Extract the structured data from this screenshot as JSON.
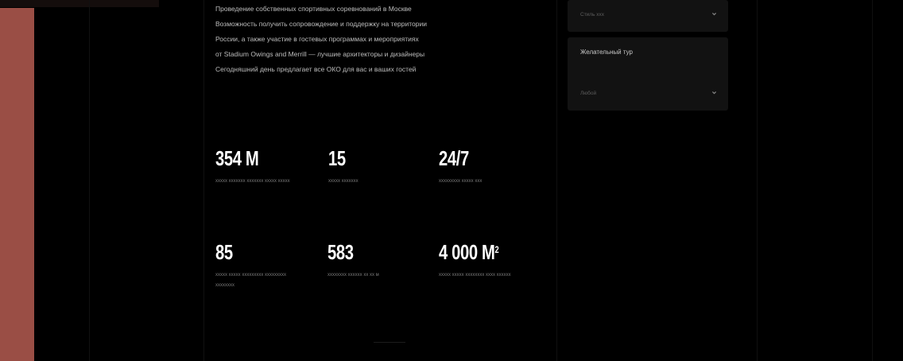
{
  "intro": {
    "lines": [
      "Проведение собственных спортивных соревнований в Москве",
      "Возможность получить сопровождение и поддержку на территории",
      "России, а также участие в гостевых программах и мероприятиях",
      "от Stadium Owings and Merrill — лучшие архитекторы и дизайнеры",
      "Сегодняшний день предлагает все ОКО для вас и ваших гостей"
    ]
  },
  "stats": [
    {
      "value": "354 M",
      "sup": "",
      "caption": "ххххх ххххххх ххххххх ххххх ххххх"
    },
    {
      "value": "15",
      "sup": "",
      "caption": "ххххх ххххххх"
    },
    {
      "value": "24/7",
      "sup": "",
      "caption": "ххххххххх ххххх ххх"
    },
    {
      "value": "85",
      "sup": "",
      "caption": "ххххх ххххх ххххххххх ххххххххх хххххххх"
    },
    {
      "value": "583",
      "sup": "",
      "caption": "хххххххх хххххх хх хх м"
    },
    {
      "value": "4 000 M",
      "sup": "2",
      "caption": "ххххх ххххх хххххххх хххх хххххх"
    }
  ],
  "filters": {
    "first": {
      "value": "Стиль ххх"
    },
    "second": {
      "label": "Желательный тур",
      "value": "Любой"
    }
  },
  "colors": {
    "accent": "#9a4e45",
    "background": "#000000",
    "panel": "#121212"
  },
  "icons": {
    "select_chevron": "chevron-down-icon"
  }
}
